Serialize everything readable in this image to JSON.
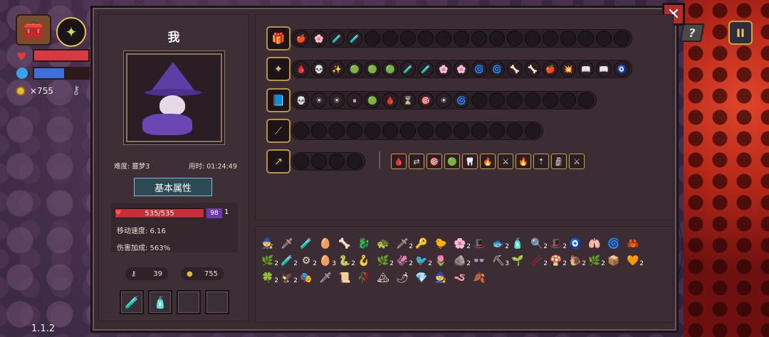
{
  "hud": {
    "coins": "×755",
    "hp_icon": "heart-icon",
    "mana_icon": "mana-orb-icon"
  },
  "version": "1.1.2",
  "help_label": "?",
  "pause_label": "II",
  "close_label": "✕",
  "player": {
    "name": "我",
    "difficulty": "难度: 噩梦3",
    "time": "用时: 01:24:49",
    "tab_label": "基本属性",
    "hp": "535/535",
    "armor": "98",
    "armor_extra": "1",
    "move_speed": "移动速度: 6.16",
    "damage_bonus": "伤害加成: 563%",
    "keys": "39",
    "coins": "755",
    "potions": [
      "🧪",
      "🧴",
      "",
      ""
    ]
  },
  "weapons": [
    {
      "icon": "chest-icon",
      "glyph": "🎁",
      "slots": 19,
      "filled": [
        "🍎",
        "🌸",
        "🧪",
        "🧪"
      ]
    },
    {
      "icon": "staff-icon",
      "glyph": "✦",
      "slots": 18,
      "filled": [
        "🩸",
        "💀",
        "✨",
        "🟢",
        "🟢",
        "🟢",
        "🧪",
        "🧪",
        "🌸",
        "🌸",
        "🌀",
        "🌀",
        "🦴",
        "🦴",
        "🍎",
        "💥",
        "📖",
        "📖",
        "🧿"
      ]
    },
    {
      "icon": "spellbook-icon",
      "glyph": "📘",
      "slots": 17,
      "filled": [
        "💀",
        "☀",
        "☀",
        "⏸",
        "🟢",
        "🩸",
        "⌛",
        "🎯",
        "☀",
        "🌀"
      ]
    },
    {
      "icon": "wand-icon",
      "glyph": "⟋",
      "slots": 14,
      "filled": []
    },
    {
      "icon": "spear-icon",
      "glyph": "↗",
      "slots": 4,
      "filled": []
    }
  ],
  "spear_chips": [
    "🩸",
    "⇄",
    "🎯",
    "🟢",
    "🦷",
    "🔥",
    "⚔",
    "🔥",
    "⇡",
    "🗿",
    "⚔"
  ],
  "items": [
    {
      "g": "🧙",
      "n": ""
    },
    {
      "g": "🗡",
      "n": ""
    },
    {
      "g": "🧪",
      "n": ""
    },
    {
      "g": "🥚",
      "n": ""
    },
    {
      "g": "🦴",
      "n": ""
    },
    {
      "g": "🐉",
      "n": ""
    },
    {
      "g": "🐢",
      "n": ""
    },
    {
      "g": "🗡",
      "n": "2"
    },
    {
      "g": "🔑",
      "n": ""
    },
    {
      "g": "🐤",
      "n": ""
    },
    {
      "g": "🌸",
      "n": "2"
    },
    {
      "g": "🎩",
      "n": ""
    },
    {
      "g": "🐟",
      "n": "2"
    },
    {
      "g": "🧴",
      "n": ""
    },
    {
      "g": "🔍",
      "n": "2"
    },
    {
      "g": "🎩",
      "n": "2"
    },
    {
      "g": "🧿",
      "n": ""
    },
    {
      "g": "🫁",
      "n": ""
    },
    {
      "g": "🌀",
      "n": ""
    },
    {
      "g": "🦀",
      "n": ""
    },
    {
      "g": "🌿",
      "n": "2"
    },
    {
      "g": "🧪",
      "n": "2"
    },
    {
      "g": "⚙",
      "n": "2"
    },
    {
      "g": "🥚",
      "n": "3"
    },
    {
      "g": "🐍",
      "n": "2"
    },
    {
      "g": "🪝",
      "n": ""
    },
    {
      "g": "🌿",
      "n": "2"
    },
    {
      "g": "🦑",
      "n": "2"
    },
    {
      "g": "🐦",
      "n": "2"
    },
    {
      "g": "🌷",
      "n": ""
    },
    {
      "g": "🪨",
      "n": "2"
    },
    {
      "g": "👓",
      "n": ""
    },
    {
      "g": "⛏",
      "n": "3"
    },
    {
      "g": "🌱",
      "n": ""
    },
    {
      "g": "🥢",
      "n": "2"
    },
    {
      "g": "🍄",
      "n": "2"
    },
    {
      "g": "🐌",
      "n": "2"
    },
    {
      "g": "🌿",
      "n": "2"
    },
    {
      "g": "📦",
      "n": ""
    },
    {
      "g": "🧡",
      "n": "2"
    },
    {
      "g": "🍀",
      "n": "2"
    },
    {
      "g": "🦅",
      "n": "2"
    },
    {
      "g": "🎭",
      "n": ""
    },
    {
      "g": "🗡",
      "n": ""
    },
    {
      "g": "📜",
      "n": ""
    },
    {
      "g": "🥀",
      "n": ""
    },
    {
      "g": "🏔",
      "n": ""
    },
    {
      "g": "🌶",
      "n": ""
    },
    {
      "g": "💎",
      "n": ""
    },
    {
      "g": "🧙",
      "n": ""
    },
    {
      "g": "🪱",
      "n": ""
    },
    {
      "g": "🍂",
      "n": ""
    }
  ]
}
